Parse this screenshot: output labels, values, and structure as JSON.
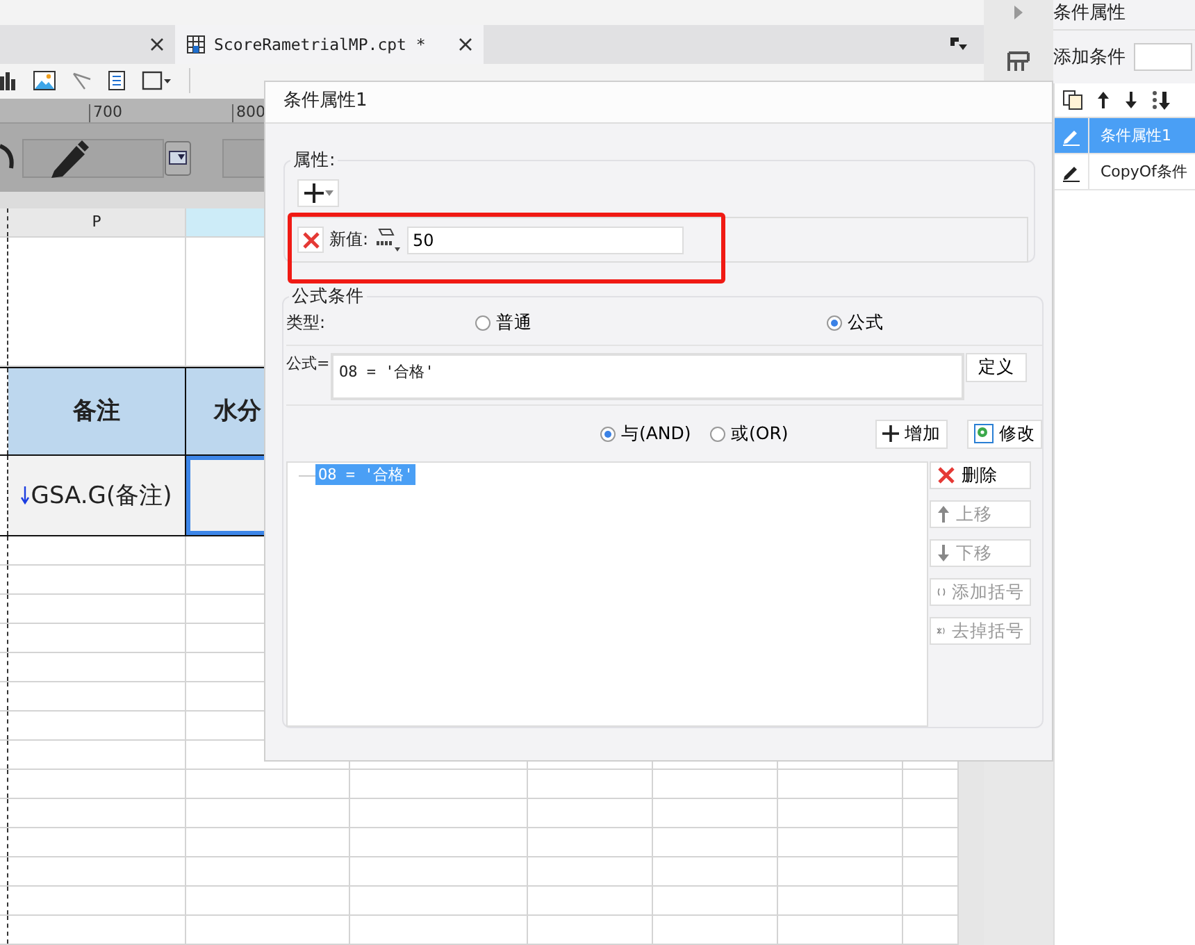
{
  "tabs": [
    {
      "selected": false
    },
    {
      "label": "ScoreRametrialMP.cpt *",
      "selected": true
    }
  ],
  "ruler": {
    "marks": [
      "700",
      "800"
    ]
  },
  "sheet": {
    "columns": [
      "P"
    ],
    "header_cells": [
      "备注",
      "水分"
    ],
    "data_cells": [
      "GSA.G(备注)"
    ]
  },
  "dialog": {
    "title": "条件属性1",
    "property_section": {
      "label": "属性:",
      "rows": [
        {
          "label": "新值:",
          "value": "50"
        }
      ]
    },
    "formula_section": {
      "label": "公式条件",
      "type_label": "类型:",
      "type_options": [
        {
          "label": "普通",
          "selected": false
        },
        {
          "label": "公式",
          "selected": true
        }
      ],
      "formula_label": "公式=",
      "formula": "O8 = '合格'",
      "define_button": "定义",
      "logic_options": [
        {
          "label": "与(AND)",
          "selected": true
        },
        {
          "label": "或(OR)",
          "selected": false
        }
      ],
      "add_button": "增加",
      "modify_button": "修改",
      "conditions": [
        {
          "text": "O8 = '合格'",
          "selected": true
        }
      ],
      "actions": [
        {
          "kind": "delete",
          "label": "删除",
          "disabled": false
        },
        {
          "kind": "up",
          "label": "上移",
          "disabled": true
        },
        {
          "kind": "down",
          "label": "下移",
          "disabled": true
        },
        {
          "kind": "add-parens",
          "label": "添加括号",
          "disabled": true
        },
        {
          "kind": "remove-parens",
          "label": "去掉括号",
          "disabled": true
        }
      ]
    }
  },
  "right_panel": {
    "title": "条件属性",
    "add_label": "添加条件",
    "items": [
      {
        "label": "条件属性1",
        "selected": true
      },
      {
        "label": "CopyOf条件",
        "selected": false
      }
    ]
  }
}
